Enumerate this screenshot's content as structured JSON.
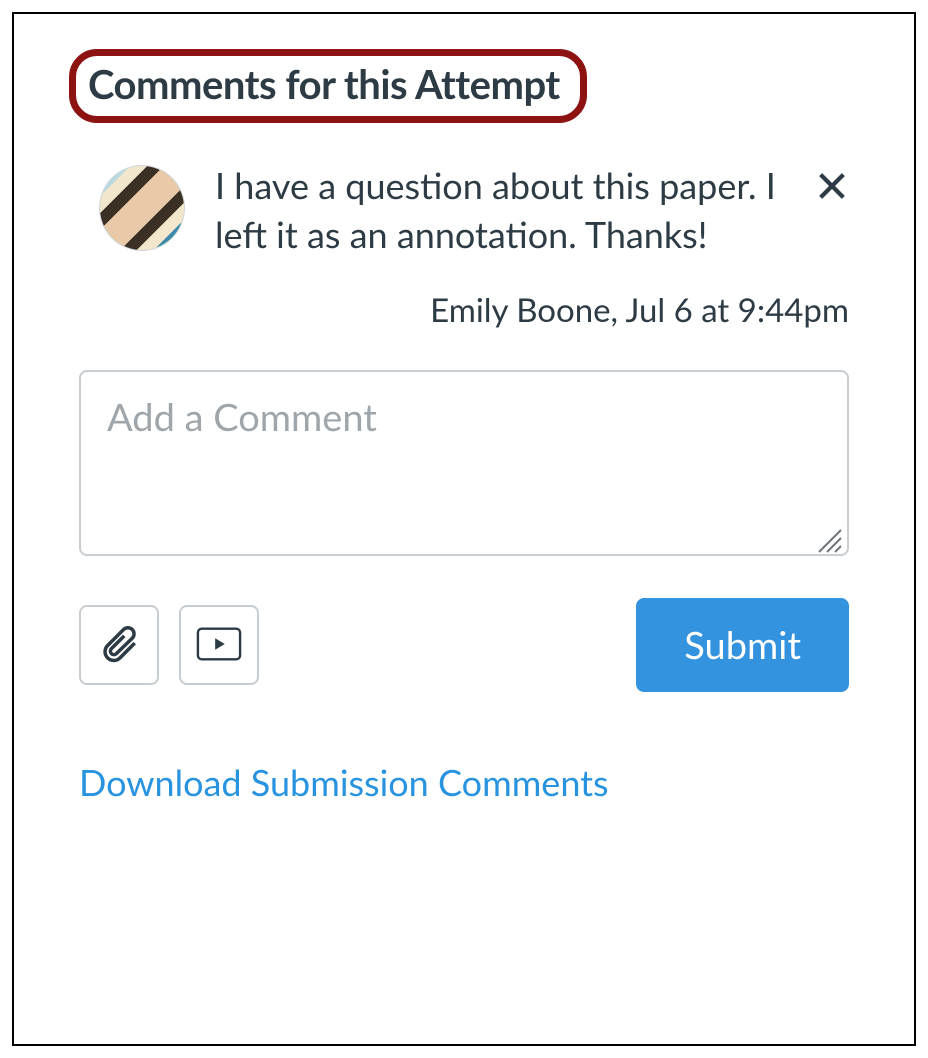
{
  "heading": "Comments for this Attempt",
  "comment": {
    "text": "I have a question about this paper. I left it as an annotation. Thanks!",
    "author": "Emily Boone",
    "timestamp": "Jul 6 at 9:44pm",
    "meta": "Emily Boone, Jul 6 at 9:44pm"
  },
  "input": {
    "placeholder": "Add a Comment"
  },
  "actions": {
    "submit": "Submit"
  },
  "download_link": "Download Submission Comments"
}
